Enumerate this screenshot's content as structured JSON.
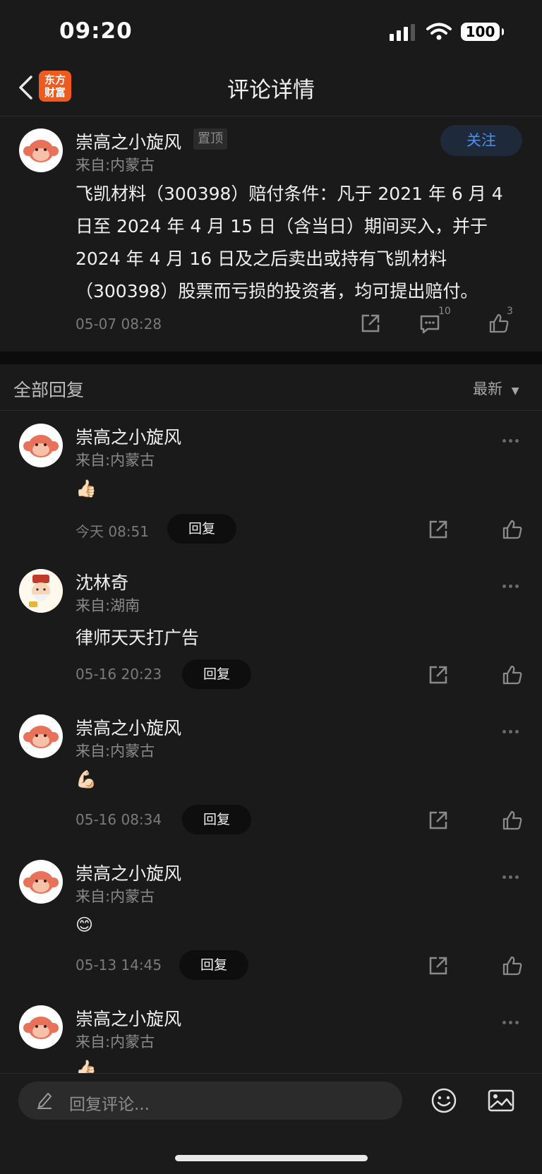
{
  "status_bar": {
    "time": "09:20",
    "battery": "100"
  },
  "nav": {
    "title": "评论详情",
    "logo_line1": "东方",
    "logo_line2": "财富"
  },
  "post": {
    "author": "崇高之小旋风",
    "pin_label": "置顶",
    "location": "来自:内蒙古",
    "follow_label": "关注",
    "content": "飞凯材料（300398）赔付条件：凡于 2021 年 6 月 4 日至 2024 年 4 月 15 日（含当日）期间买入，并于 2024 年 4 月 16 日及之后卖出或持有飞凯材料（300398）股票而亏损的投资者，均可提出赔付。",
    "time": "05-07 08:28",
    "comment_count": "10",
    "like_count": "3"
  },
  "replies_header": {
    "title": "全部回复",
    "sort": "最新"
  },
  "replies": [
    {
      "author": "崇高之小旋风",
      "location": "来自:内蒙古",
      "content": "👍🏻",
      "time": "今天 08:51",
      "reply_label": "回复"
    },
    {
      "author": "沈林奇",
      "location": "来自:湖南",
      "content": "律师天天打广告",
      "time": "05-16 20:23",
      "reply_label": "回复"
    },
    {
      "author": "崇高之小旋风",
      "location": "来自:内蒙古",
      "content": "💪🏻",
      "time": "05-16 08:34",
      "reply_label": "回复"
    },
    {
      "author": "崇高之小旋风",
      "location": "来自:内蒙古",
      "content": "😊",
      "time": "05-13 14:45",
      "reply_label": "回复"
    },
    {
      "author": "崇高之小旋风",
      "location": "来自:内蒙古",
      "content": "👍🏻"
    }
  ],
  "bottom": {
    "placeholder": "回复评论..."
  },
  "colors": {
    "accent": "#4d8fe8",
    "brand": "#ef5a1e",
    "background": "#1a1a1a"
  }
}
